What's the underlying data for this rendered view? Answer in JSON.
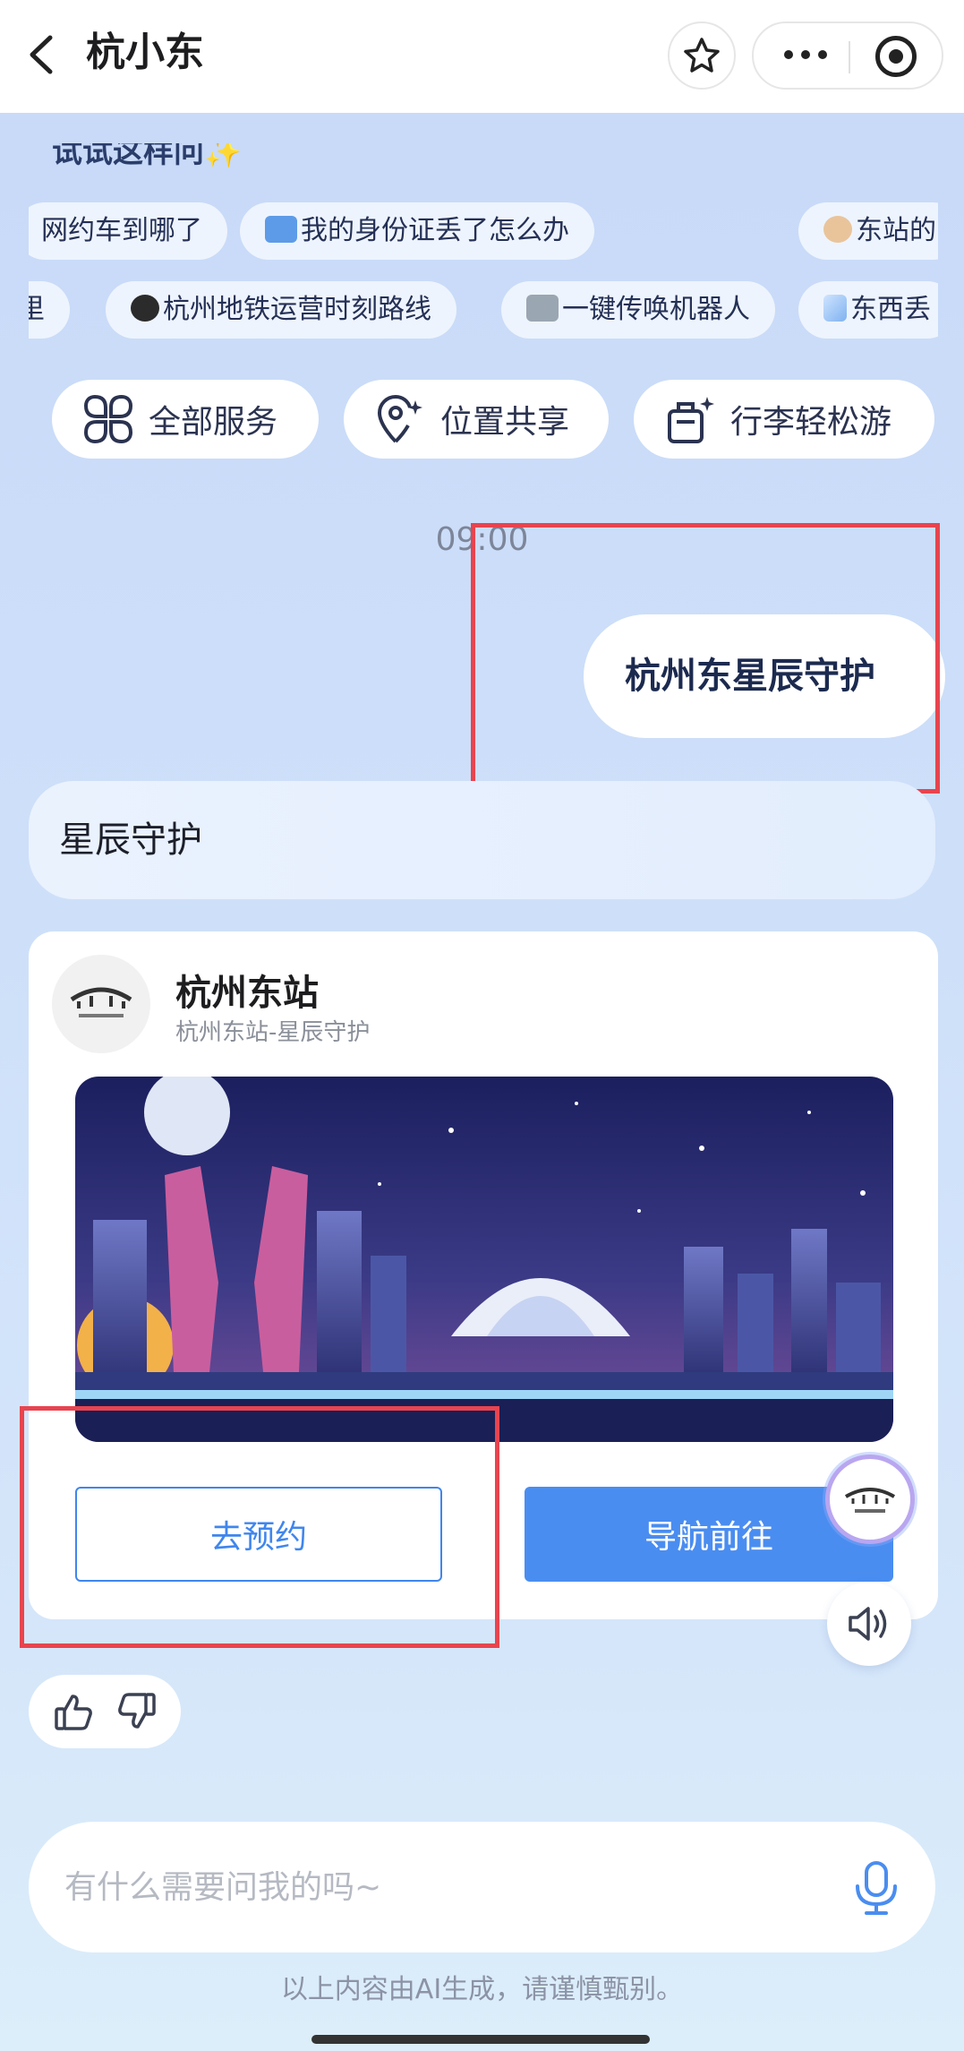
{
  "header": {
    "title": "杭小东"
  },
  "suggestions": {
    "title": "试试这样问✨",
    "row1": [
      {
        "label": "网约车到哪了",
        "emoji": ""
      },
      {
        "label": "我的身份证丢了怎么办",
        "emoji": "id-card-emoji"
      },
      {
        "label": "东站的",
        "emoji": "police-officer-emoji"
      }
    ],
    "row2": [
      {
        "label": "里",
        "emoji": ""
      },
      {
        "label": "杭州地铁运营时刻路线",
        "emoji": "metro-emoji"
      },
      {
        "label": "一键传唤机器人",
        "emoji": "robot-emoji"
      },
      {
        "label": "东西丢",
        "emoji": "comet-emoji"
      }
    ]
  },
  "services": [
    {
      "label": "全部服务",
      "icon": "grid-icon"
    },
    {
      "label": "位置共享",
      "icon": "location-share-icon"
    },
    {
      "label": "行李轻松游",
      "icon": "luggage-icon"
    }
  ],
  "chat": {
    "time": "09:00",
    "user_message": "杭州东星辰守护",
    "bot_reply": "星辰守护",
    "card": {
      "station_name": "杭州东站",
      "subtitle": "杭州东站-星辰守护",
      "book_label": "去预约",
      "navigate_label": "导航前往"
    }
  },
  "input": {
    "placeholder": "有什么需要问我的吗~"
  },
  "disclaimer": "以上内容由AI生成，请谨慎甄别。",
  "colors": {
    "accent": "#4a8df0",
    "highlight": "#e8444f",
    "background": "#c7d9f8"
  }
}
